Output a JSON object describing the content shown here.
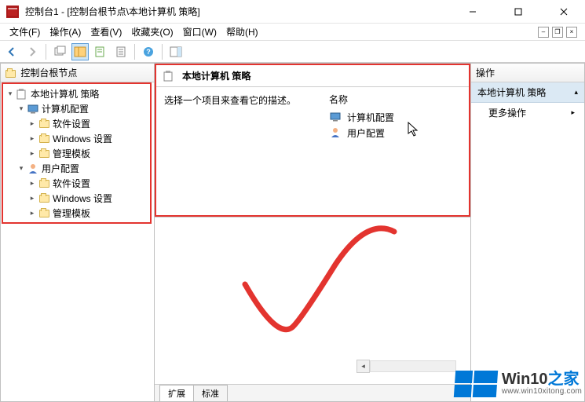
{
  "titlebar": {
    "title": "控制台1 - [控制台根节点\\本地计算机 策略]"
  },
  "menu": {
    "file": "文件(F)",
    "action": "操作(A)",
    "view": "查看(V)",
    "favorites": "收藏夹(O)",
    "window": "窗口(W)",
    "help": "帮助(H)"
  },
  "tree": {
    "root": "控制台根节点",
    "policy": "本地计算机 策略",
    "computer": "计算机配置",
    "software1": "软件设置",
    "windows1": "Windows 设置",
    "templates1": "管理模板",
    "user": "用户配置",
    "software2": "软件设置",
    "windows2": "Windows 设置",
    "templates2": "管理模板"
  },
  "center": {
    "header": "本地计算机 策略",
    "prompt": "选择一个项目来查看它的描述。",
    "col_name": "名称",
    "item_computer": "计算机配置",
    "item_user": "用户配置",
    "tab_extended": "扩展",
    "tab_standard": "标准"
  },
  "actions": {
    "header": "操作",
    "section": "本地计算机 策略",
    "more": "更多操作"
  },
  "watermark": {
    "brand_a": "Win10",
    "brand_b": "之家",
    "url": "www.win10xitong.com"
  }
}
